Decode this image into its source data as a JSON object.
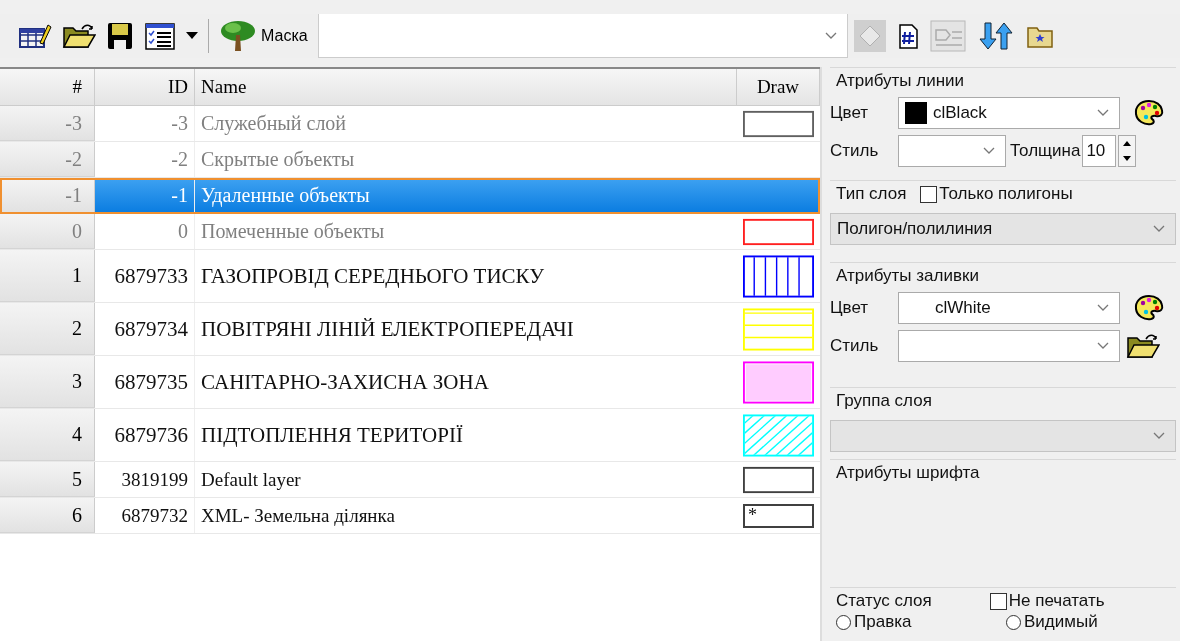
{
  "toolbar": {
    "mask_label": "Маска"
  },
  "table": {
    "columns": [
      "#",
      "ID",
      "Name",
      "Draw"
    ],
    "rows": [
      {
        "num": "-3",
        "id": "-3",
        "name": "Служебный слой",
        "kind": "system",
        "selected": false,
        "swatch": {
          "kind": "plain",
          "color": "#606060"
        }
      },
      {
        "num": "-2",
        "id": "-2",
        "name": "Скрытые объекты",
        "kind": "system",
        "selected": false,
        "swatch": {
          "kind": "none"
        }
      },
      {
        "num": "-1",
        "id": "-1",
        "name": "Удаленные объекты",
        "kind": "system",
        "selected": true,
        "swatch": {
          "kind": "none"
        }
      },
      {
        "num": "0",
        "id": "0",
        "name": "Помеченные объекты",
        "kind": "system",
        "selected": false,
        "swatch": {
          "kind": "plain",
          "color": "#ff2020"
        }
      },
      {
        "num": "1",
        "id": "6879733",
        "name": "ГАЗОПРОВІД СЕРЕДНЬОГО ТИСКУ",
        "kind": "caps",
        "selected": false,
        "swatch": {
          "kind": "vertical",
          "color": "#0000ff"
        }
      },
      {
        "num": "2",
        "id": "6879734",
        "name": "ПОВІТРЯНІ ЛІНІЙ ЕЛЕКТРОПЕРЕДАЧІ",
        "kind": "caps",
        "selected": false,
        "swatch": {
          "kind": "horizontal",
          "color": "#ffff00"
        }
      },
      {
        "num": "3",
        "id": "6879735",
        "name": "САНІТАРНО-ЗАХИСНА ЗОНА",
        "kind": "caps",
        "selected": false,
        "swatch": {
          "kind": "solid",
          "color": "#ff00ff"
        }
      },
      {
        "num": "4",
        "id": "6879736",
        "name": "ПІДТОПЛЕННЯ ТЕРИТОРІЇ",
        "kind": "caps",
        "selected": false,
        "swatch": {
          "kind": "diagonal",
          "color": "#00ffff"
        }
      },
      {
        "num": "5",
        "id": "3819199",
        "name": "Default layer",
        "kind": "normal",
        "selected": false,
        "swatch": {
          "kind": "plain",
          "color": "#404040"
        }
      },
      {
        "num": "6",
        "id": "6879732",
        "name": "XML- Земельна ділянка",
        "kind": "normal",
        "selected": false,
        "swatch": {
          "kind": "marker",
          "color": "#404040",
          "mark": "*"
        }
      }
    ]
  },
  "line_attributes": {
    "title": "Атрибуты линии",
    "color_label": "Цвет",
    "color_value": "clBlack",
    "color": "#000000",
    "style_label": "Стиль",
    "width_label": "Толщина",
    "width_value": "10"
  },
  "layer_type": {
    "title": "Тип слоя",
    "polygons_only": {
      "label": "Только полигоны",
      "checked": false
    },
    "value": "Полигон/полилиния"
  },
  "fill_attributes": {
    "title": "Атрибуты заливки",
    "color_label": "Цвет",
    "color_value": "clWhite",
    "style_label": "Стиль"
  },
  "layer_group": {
    "title": "Группа слоя"
  },
  "font_attributes": {
    "title": "Атрибуты шрифта"
  },
  "layer_status": {
    "title": "Статус слоя",
    "no_print": {
      "label": "Не печатать",
      "checked": false
    },
    "radios": [
      {
        "label": "Правка",
        "selected": false
      },
      {
        "label": "Видимый",
        "selected": false
      }
    ]
  }
}
